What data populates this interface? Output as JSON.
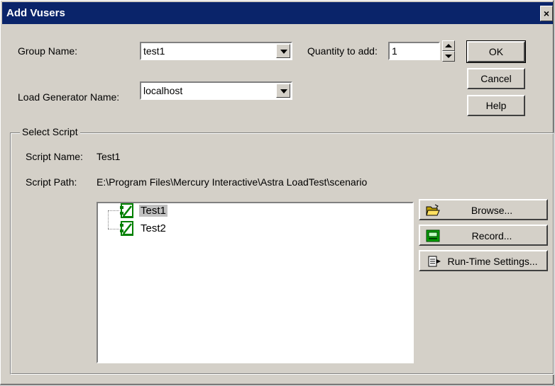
{
  "window": {
    "title": "Add Vusers",
    "close_glyph": "×"
  },
  "form": {
    "group_name_label": "Group Name:",
    "group_name_value": "test1",
    "load_generator_label": "Load Generator Name:",
    "load_generator_value": "localhost",
    "quantity_label": "Quantity to add:",
    "quantity_value": "1"
  },
  "buttons": {
    "ok": "OK",
    "cancel": "Cancel",
    "help": "Help"
  },
  "select_script": {
    "group_label": "Select Script",
    "script_name_label": "Script Name:",
    "script_name_value": "Test1",
    "script_path_label": "Script Path:",
    "script_path_value": "E:\\Program Files\\Mercury Interactive\\Astra LoadTest\\scenario",
    "scripts": [
      {
        "name": "Test1",
        "icon": "script-icon",
        "selected": true
      },
      {
        "name": "Test2",
        "icon": "script-icon",
        "selected": false
      }
    ],
    "browse_label": "Browse...",
    "record_label": "Record...",
    "runtime_label": "Run-Time Settings..."
  },
  "colors": {
    "titlebar": "#0a246a",
    "face": "#d4d0c8",
    "script_icon": "#008000"
  }
}
